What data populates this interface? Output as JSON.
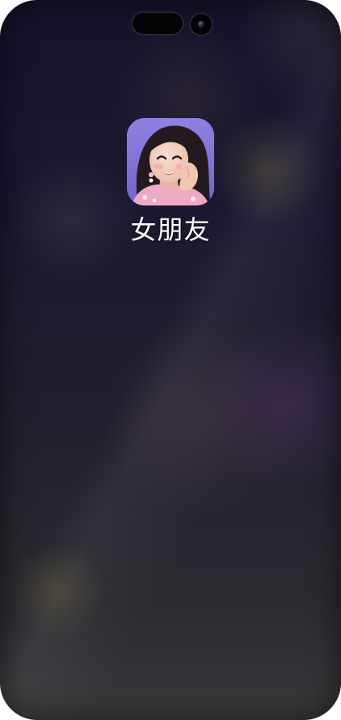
{
  "home_screen": {
    "apps": [
      {
        "label": "女朋友",
        "icon": "girlfriend-avatar-icon",
        "icon_background": "#8d7fdc"
      }
    ]
  },
  "hardware": {
    "island": "dynamic-island",
    "camera": "front-camera-icon"
  }
}
